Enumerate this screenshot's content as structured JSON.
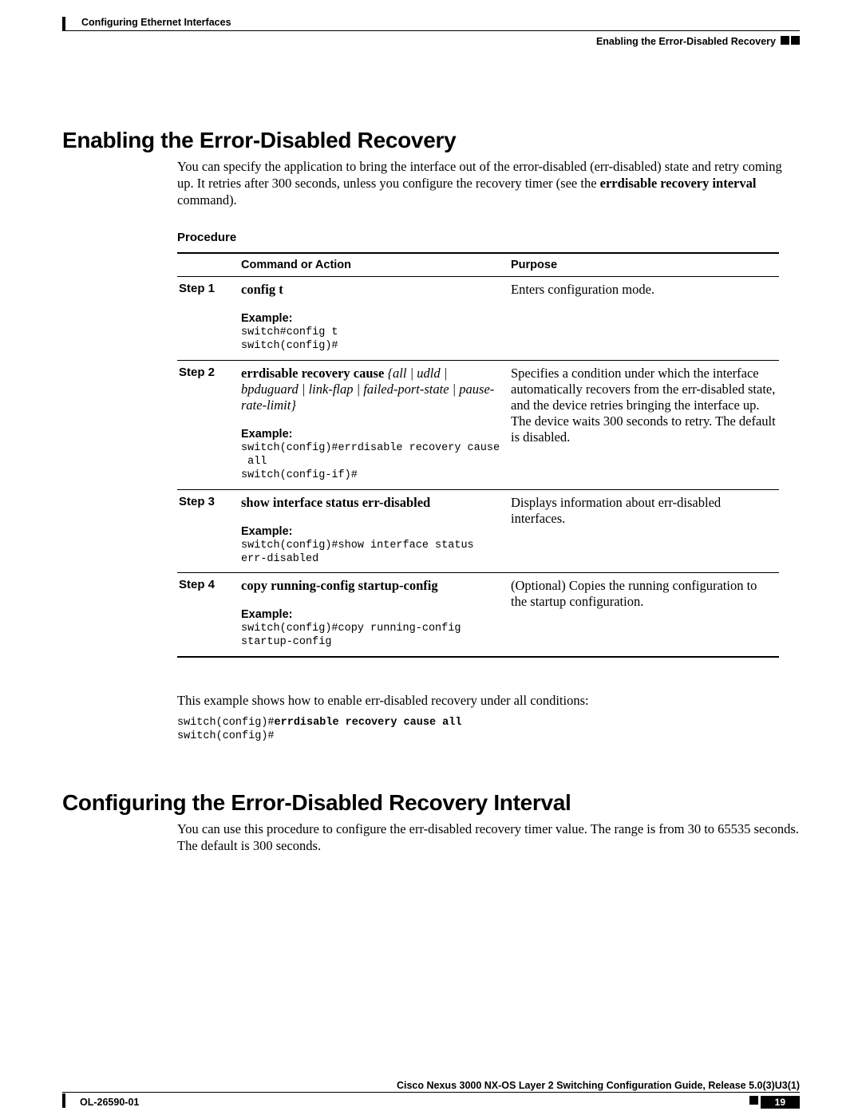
{
  "header": {
    "chapter": "Configuring Ethernet Interfaces",
    "section": "Enabling the Error-Disabled Recovery"
  },
  "sections": [
    {
      "title": "Enabling the Error-Disabled Recovery",
      "intro_parts": {
        "p1": "You can specify the application to bring the interface out of the error-disabled (err-disabled) state and retry coming up. It retries after 300 seconds, unless you configure the recovery timer (see the ",
        "bold": "errdisable recovery interval",
        "p2": " command)."
      }
    },
    {
      "title": "Configuring the Error-Disabled Recovery Interval",
      "intro": "You can use this procedure to configure the err-disabled recovery timer value. The range is from 30 to 65535 seconds. The default is 300 seconds."
    }
  ],
  "procedure_label": "Procedure",
  "table": {
    "headers": {
      "step": "",
      "cmd": "Command or Action",
      "purpose": "Purpose"
    },
    "rows": [
      {
        "step": "Step 1",
        "cmd_bold": "config t",
        "example_label": "Example:",
        "code": "switch#config t\nswitch(config)#",
        "purpose": "Enters configuration mode."
      },
      {
        "step": "Step 2",
        "cmd_bold": "errdisable recovery cause",
        "cmd_italic": " {all | udld | bpduguard | link-flap | failed-port-state | pause-rate-limit}",
        "example_label": "Example:",
        "code": "switch(config)#errdisable recovery cause\n all\nswitch(config-if)#",
        "purpose": "Specifies a condition under which the interface automatically recovers from the err-disabled state, and the device retries bringing the interface up. The device waits 300 seconds to retry. The default is disabled."
      },
      {
        "step": "Step 3",
        "cmd_bold": "show interface status err-disabled",
        "example_label": "Example:",
        "code": "switch(config)#show interface status\nerr-disabled",
        "purpose": "Displays information about err-disabled interfaces."
      },
      {
        "step": "Step 4",
        "cmd_bold": "copy running-config startup-config",
        "example_label": "Example:",
        "code": "switch(config)#copy running-config\nstartup-config",
        "purpose": "(Optional) Copies the running configuration to the startup configuration."
      }
    ]
  },
  "post_example": {
    "text": "This example shows how to enable err-disabled recovery under all conditions:",
    "code_plain1": "switch(config)#",
    "code_bold": "errdisable recovery cause all",
    "code_plain2": "switch(config)#"
  },
  "footer": {
    "book": "Cisco Nexus 3000 NX-OS Layer 2 Switching Configuration Guide, Release 5.0(3)U3(1)",
    "docid": "OL-26590-01",
    "page": "19"
  }
}
